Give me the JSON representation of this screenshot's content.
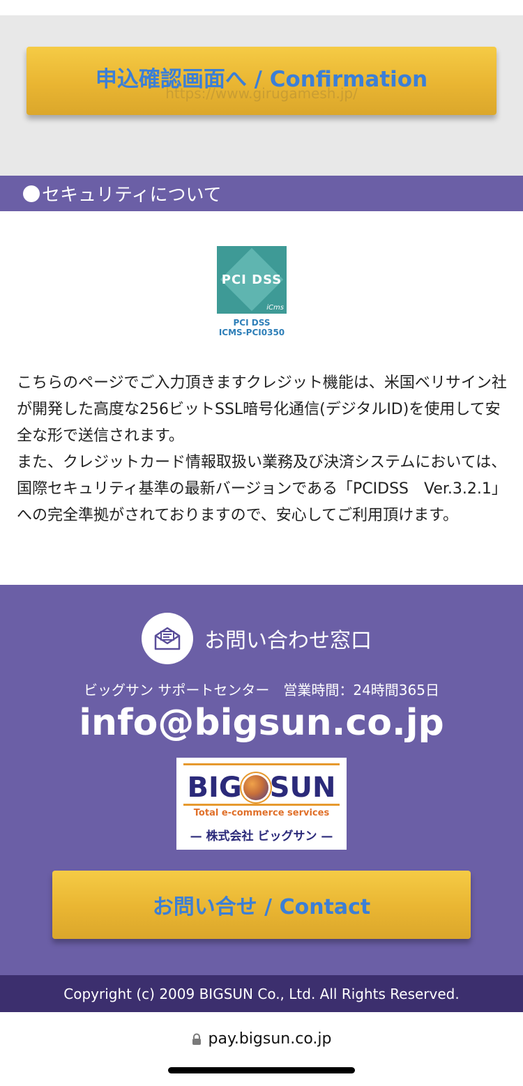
{
  "confirm_button": {
    "label": "申込確認画面へ / Confirmation",
    "watermark": "https://www.girugamesh.jp/"
  },
  "security": {
    "heading": "セキュリティについて",
    "pci_badge": {
      "logo_text": "PCI DSS",
      "sub_text": "iCms",
      "caption_line1": "PCI DSS",
      "caption_line2": "ICMS-PCI0350"
    },
    "paragraph1": "こちらのページでご入力頂きますクレジット機能は、米国ベリサイン社が開発した高度な256ビットSSL暗号化通信(デジタルID)を使用して安全な形で送信されます。",
    "paragraph2": "また、クレジットカード情報取扱い業務及び決済システムにおいては、国際セキュリティ基準の最新バージョンである「PCIDSS　Ver.3.2.1」への完全準拠がされておりますので、安心してご利用頂けます。"
  },
  "contact": {
    "title": "お問い合わせ窓口",
    "support_line": "ビッグサン サポートセンター　営業時間：24時間365日",
    "email": "info@bigsun.co.jp",
    "logo": {
      "word_left": "BIG",
      "word_right": "SUN",
      "tagline": "Total e-commerce services",
      "corp": "— 株式会社 ビッグサン —"
    },
    "button_label": "お問い合せ / Contact"
  },
  "footer": {
    "copyright": "Copyright (c) 2009 BIGSUN Co., Ltd. All Rights Reserved."
  },
  "browser": {
    "url": "pay.bigsun.co.jp",
    "lock_icon": "lock-icon"
  },
  "colors": {
    "purple": "#6b5fa6",
    "dark_purple": "#3c2f6e",
    "gold": "#e9b532",
    "button_text_blue": "#3c7fd6"
  }
}
